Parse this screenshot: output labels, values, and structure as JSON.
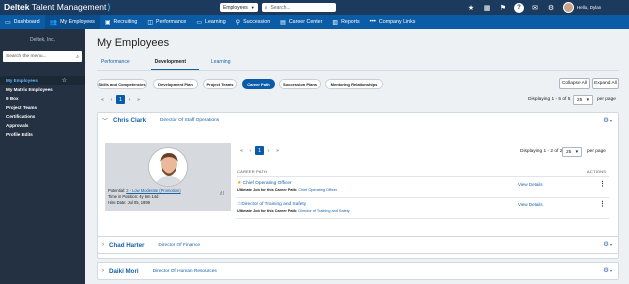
{
  "app": {
    "brand": "Deltek",
    "product": "Talent Management",
    "search_scope": "Employees",
    "search_placeholder": "Search...",
    "greeting": "Hello, Dylan"
  },
  "top_icons": [
    "star-icon",
    "grid-icon",
    "flag-icon",
    "help-icon",
    "mail-icon",
    "gear-icon"
  ],
  "nav": [
    {
      "label": "Dashboard",
      "icon": "monitor-icon"
    },
    {
      "label": "My Employees",
      "icon": "people-icon"
    },
    {
      "label": "Recruiting",
      "icon": "briefcase-icon"
    },
    {
      "label": "Performance",
      "icon": "performance-icon"
    },
    {
      "label": "Learning",
      "icon": "laptop-icon"
    },
    {
      "label": "Succession",
      "icon": "pin-icon"
    },
    {
      "label": "Career Center",
      "icon": "person-icon"
    },
    {
      "label": "Reports",
      "icon": "chart-icon"
    },
    {
      "label": "Company Links",
      "icon": "more-icon"
    }
  ],
  "sidebar": {
    "org": "Deltek, Inc.",
    "search_placeholder": "Search the menu...",
    "items": [
      {
        "label": "My Employees"
      },
      {
        "label": "My Matrix Employees"
      },
      {
        "label": "9 Box"
      },
      {
        "label": "Project Teams"
      },
      {
        "label": "Certifications"
      },
      {
        "label": "Approvals"
      },
      {
        "label": "Profile Edits"
      }
    ]
  },
  "page": {
    "title": "My Employees",
    "tabs": [
      "Performance",
      "Development",
      "Learning"
    ],
    "active_tab": "Development",
    "subtabs": [
      "Skills and Competencies",
      "Development Plan",
      "Project Teams",
      "Career Path",
      "Succession Plans",
      "Mentoring Relationships"
    ],
    "active_subtab": "Career Path",
    "collapse_all": "Collapse All",
    "expand_all": "Expand All",
    "pager": {
      "first": "«",
      "prev": "‹",
      "page": "1",
      "next": "›",
      "last": "»"
    },
    "displaying": "Displaying 1 - 5 of 5",
    "per_page_value": "25",
    "per_page_label": "per page"
  },
  "employees": [
    {
      "name": "Chris Clark",
      "title": "Director Of Staff Operations",
      "potential_label": "Potential:",
      "potential_value": "2 - Low Moderate (Promotion)",
      "time_in_position": "Time in Position: 4y 6m 14d",
      "hire_date": "Hire Date: Jul 05, 1999",
      "career_path": {
        "displaying": "Displaying 1 - 2 of 2",
        "per_page_value": "25",
        "per_page_label": "per page",
        "col_path": "CAREER PATH",
        "col_actions": "ACTIONS",
        "rows": [
          {
            "title": "Chief Operating Officer",
            "sub_prefix": "Ultimate Job for this Career Path:",
            "sub_value": "Chief Operating Officer",
            "action": "View Details",
            "starred": true
          },
          {
            "title": "Director of Training and Safety",
            "sub_prefix": "Ultimate Job for this Career Path:",
            "sub_value": "Director of Training and Safety",
            "action": "View Details",
            "starred": false
          }
        ]
      }
    },
    {
      "name": "Chad Harter",
      "title": "Director Of Finance"
    },
    {
      "name": "Daiki Mori",
      "title": "Director Of Human Resources"
    }
  ],
  "colors": {
    "topbar": "#1c3a5e",
    "navbar": "#0a5ca6",
    "sidebar": "#243142",
    "accent": "#1762a7",
    "active_menu": "#59b6ff"
  }
}
